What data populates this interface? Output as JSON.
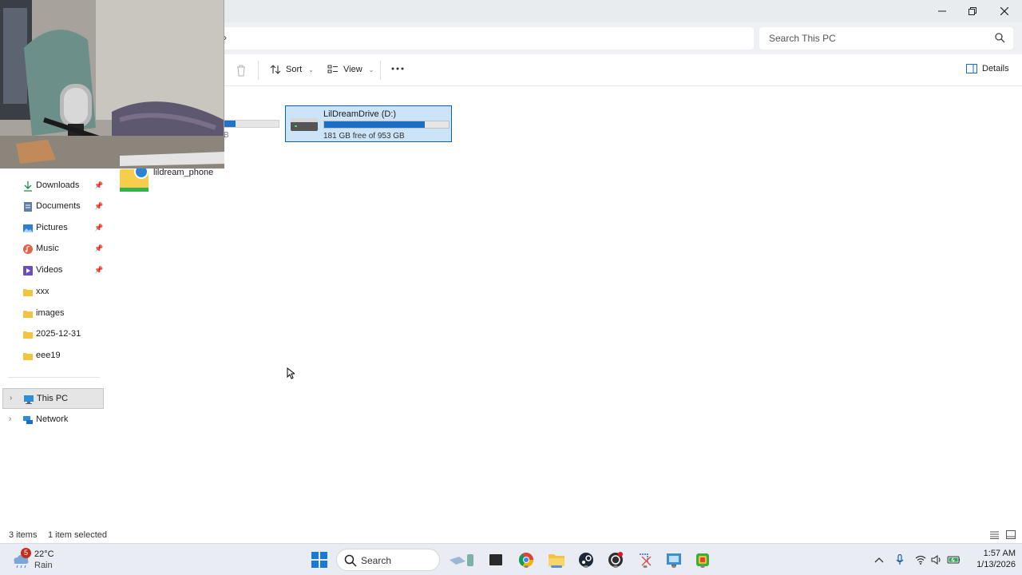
{
  "window": {
    "minimize_icon": "minimize-icon",
    "restore_icon": "restore-icon",
    "close_icon": "close-icon"
  },
  "search": {
    "placeholder": "Search This PC"
  },
  "toolbar": {
    "sort_label": "Sort",
    "view_label": "View",
    "details_label": "Details"
  },
  "sidebar": {
    "items": [
      {
        "label": "Downloads",
        "icon": "download-icon",
        "pinned": true
      },
      {
        "label": "Documents",
        "icon": "document-icon",
        "pinned": true
      },
      {
        "label": "Pictures",
        "icon": "picture-icon",
        "pinned": true
      },
      {
        "label": "Music",
        "icon": "music-icon",
        "pinned": true
      },
      {
        "label": "Videos",
        "icon": "video-icon",
        "pinned": true
      },
      {
        "label": "xxx",
        "icon": "folder-icon",
        "pinned": false
      },
      {
        "label": "images",
        "icon": "folder-icon",
        "pinned": false
      },
      {
        "label": "2025-12-31",
        "icon": "folder-icon",
        "pinned": false
      },
      {
        "label": "eee19",
        "icon": "folder-icon",
        "pinned": false
      }
    ],
    "this_pc": "This PC",
    "network": "Network"
  },
  "content": {
    "partial_drive_text": "B",
    "partial_drive_used_fraction": 0.2,
    "drive": {
      "name": "LilDreamDrive (D:)",
      "free_text": "181 GB free of 953 GB",
      "used_fraction": 0.81
    },
    "folder": {
      "label": "lildream_phone"
    }
  },
  "status": {
    "items": "3 items",
    "selected": "1 item selected"
  },
  "taskbar": {
    "weather_temp": "22°C",
    "weather_cond": "Rain",
    "weather_badge": "5",
    "search_label": "Search",
    "time": "1:57 AM",
    "date": "1/13/2026"
  },
  "colors": {
    "accent": "#0a62b6",
    "selection": "#cce4f7",
    "drive_fill": "#1a6fc4"
  }
}
